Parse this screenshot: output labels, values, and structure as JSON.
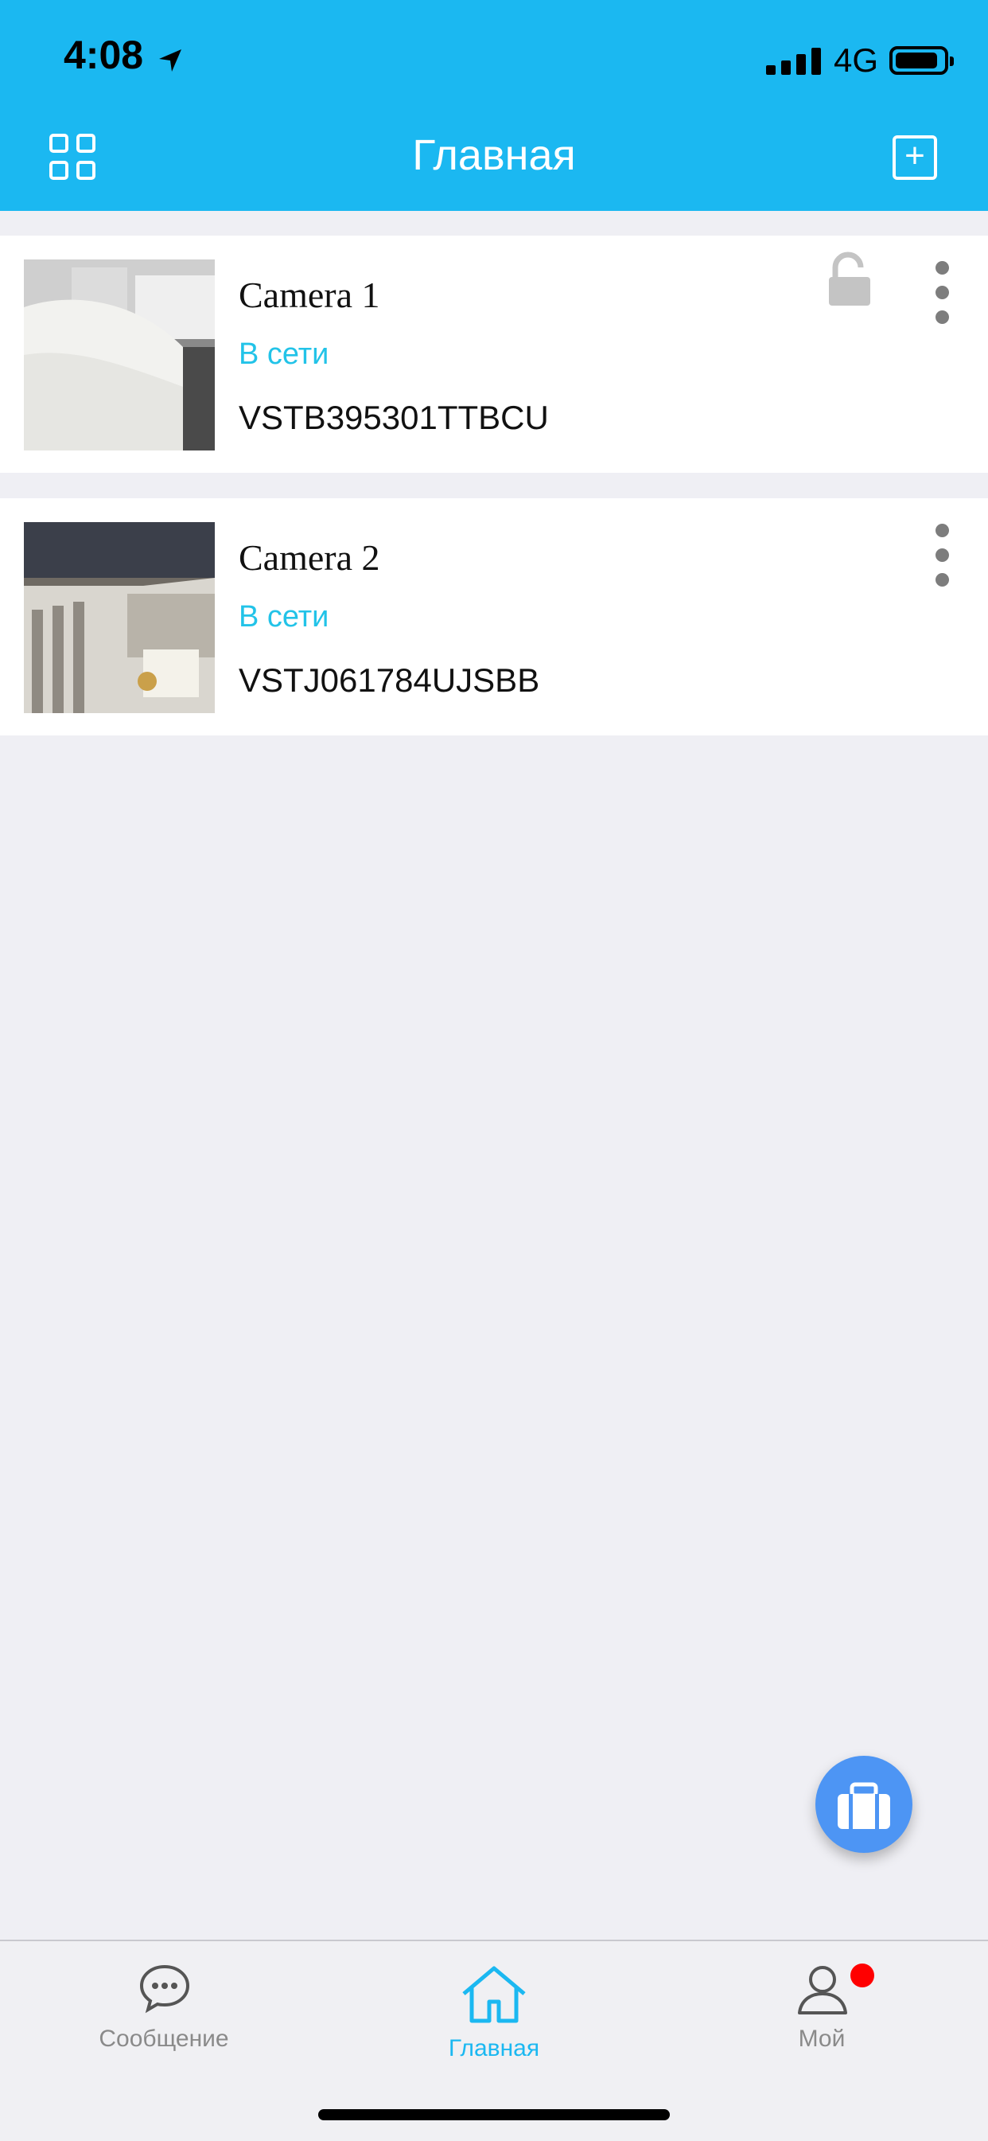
{
  "status_bar": {
    "time": "4:08",
    "network": "4G",
    "battery_level": 0.85
  },
  "header": {
    "title": "Главная",
    "left_icon": "grid-icon",
    "right_icon": "add-square-icon"
  },
  "cameras": [
    {
      "name": "Camera 1",
      "status": "В сети",
      "id": "VSTB395301TTBCU",
      "locked": false
    },
    {
      "name": "Camera 2",
      "status": "В сети",
      "id": "VSTJ061784UJSBB"
    }
  ],
  "fab": {
    "icon": "toolbox-icon"
  },
  "tabbar": {
    "items": [
      {
        "label": "Сообщение",
        "icon": "chat-bubble-icon"
      },
      {
        "label": "Главная",
        "icon": "home-icon",
        "active": true
      },
      {
        "label": "Мой",
        "icon": "user-icon",
        "has_badge": true
      }
    ]
  },
  "colors": {
    "accent": "#1bb8f1",
    "status_online": "#22c3e8",
    "background": "#efeff4",
    "fab": "#4d95f4",
    "badge": "#ff0000"
  }
}
